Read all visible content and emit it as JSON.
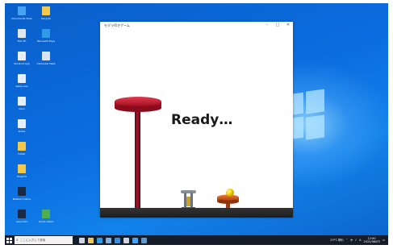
{
  "desktop": {
    "icons": [
      {
        "label": "Documents Tools",
        "icon": "app-icon",
        "color": "#4aa3f0"
      },
      {
        "label": "Recycle",
        "icon": "folder-icon",
        "color": "#f2c94c"
      },
      {
        "label": "This PC",
        "icon": "recycle-bin-icon",
        "color": "#dfe6ee"
      },
      {
        "label": "Microsoft Edge",
        "icon": "edge-icon",
        "color": "#2f9be8"
      },
      {
        "label": "Shortcut App",
        "icon": "app-icon",
        "color": "#e9eef5"
      },
      {
        "label": "Computer Data",
        "icon": "laptop-icon",
        "color": "#d8e4f0"
      },
      {
        "label": "Setup.exe",
        "icon": "file-icon",
        "color": "#e5f0ff"
      },
      {
        "label": "Docs",
        "icon": "file-icon",
        "color": "#e5f0ff"
      },
      {
        "label": "Notes",
        "icon": "file-icon",
        "color": "#e5f0ff"
      },
      {
        "label": "Folder",
        "icon": "folder-icon",
        "color": "#f2c94c"
      },
      {
        "label": "Projects",
        "icon": "folder-icon",
        "color": "#f2c94c"
      },
      {
        "label": "Network Game",
        "icon": "app-icon",
        "color": "#1b2a44"
      },
      {
        "label": "Launcher",
        "icon": "app-icon",
        "color": "#1b2a44"
      },
      {
        "label": "Game Client",
        "icon": "globe-icon",
        "color": "#4caf50"
      }
    ]
  },
  "window": {
    "title": "モグラ叩きゲーム",
    "minimize": "–",
    "maximize": "□",
    "close": "✕"
  },
  "game": {
    "status_text": "Ready…",
    "pole_color": "#8e0f1e",
    "platform_color": "#c51a32",
    "ground_color": "#262626",
    "ball_color": "#f4d000",
    "target_color": "#d9521f"
  },
  "taskbar": {
    "search_placeholder": "ここに入力して検索",
    "pinned": [
      {
        "icon": "task-view-icon",
        "color": "#cfd6e0"
      },
      {
        "icon": "file-explorer-icon",
        "color": "#f2c94c"
      },
      {
        "icon": "edge-icon",
        "color": "#2f9be8"
      },
      {
        "icon": "store-icon",
        "color": "#7fb2e6"
      },
      {
        "icon": "mail-icon",
        "color": "#3c8fde"
      },
      {
        "icon": "settings-icon",
        "color": "#cfd6e0"
      },
      {
        "icon": "app-icon",
        "color": "#4aa3f0"
      },
      {
        "icon": "game-app-icon",
        "color": "#5b9bd5"
      }
    ],
    "tray": {
      "weather": "23°C 晴れ",
      "ime": "A",
      "time": "12:00",
      "date": "2022/06/03"
    }
  }
}
